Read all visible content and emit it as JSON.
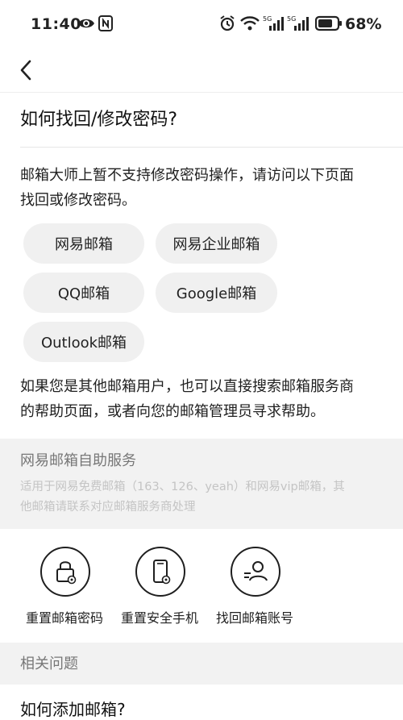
{
  "status_bar": {
    "time": "11:40",
    "battery": "68%",
    "net1": "5G",
    "net2": "5G"
  },
  "page": {
    "title": "如何找回/修改密码?",
    "intro_line1": "邮箱大师上暂不支持修改密码操作，请访问以下页面",
    "intro_line2": "找回或修改密码。",
    "chips": [
      "网易邮箱",
      "网易企业邮箱",
      "QQ邮箱",
      "Google邮箱",
      "Outlook邮箱"
    ],
    "help_line1": "如果您是其他邮箱用户，也可以直接搜索邮箱服务商",
    "help_line2": "的帮助页面，或者向您的邮箱管理员寻求帮助。"
  },
  "service": {
    "title": "网易邮箱自助服务",
    "desc_line1": "适用于网易免费邮箱（163、126、yeah）和网易vip邮箱，其",
    "desc_line2": "他邮箱请联系对应邮箱服务商处理",
    "items": [
      {
        "label": "重置邮箱密码",
        "icon": "lock-icon"
      },
      {
        "label": "重置安全手机",
        "icon": "phone-icon"
      },
      {
        "label": "找回邮箱账号",
        "icon": "user-icon"
      }
    ]
  },
  "related": {
    "title": "相关问题",
    "first_question_partial": "如何添加邮箱?"
  }
}
